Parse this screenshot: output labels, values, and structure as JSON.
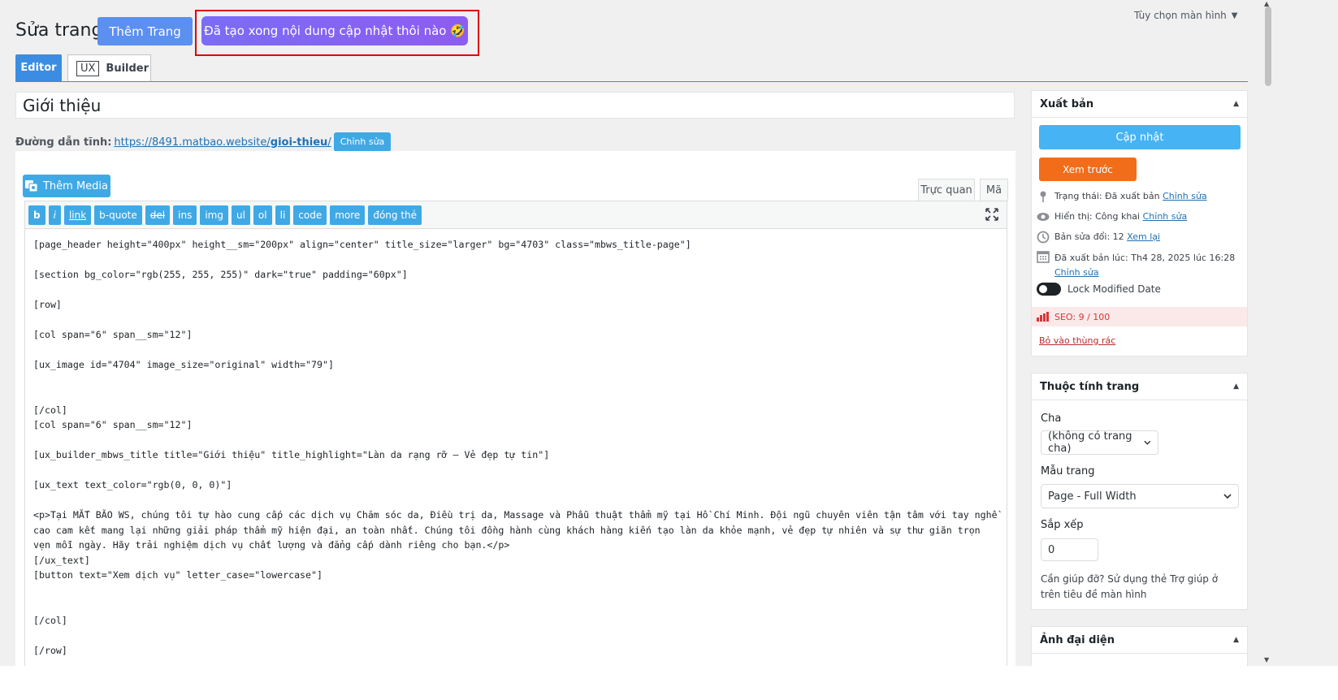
{
  "header": {
    "screen_options": "Tùy chọn màn hình",
    "page_title": "Sửa trang",
    "add_page_button": "Thêm Trang",
    "ai_button": "Đã tạo xong nội dung cập nhật thôi nào 🤣"
  },
  "editor_tabs": {
    "editor": "Editor",
    "ux_badge": "UX",
    "builder": "Builder"
  },
  "post_title": "Giới thiệu",
  "permalink": {
    "label": "Đường dẫn tĩnh:",
    "url_base": "https://8491.matbao.website/",
    "slug": "gioi-thieu",
    "url_end": "/",
    "edit_button": "Chỉnh sửa"
  },
  "media": {
    "add_media": "Thêm Media"
  },
  "mode_tabs": {
    "visual": "Trực quan",
    "code": "Mã"
  },
  "quicktags": [
    "b",
    "i",
    "link",
    "b-quote",
    "del",
    "ins",
    "img",
    "ul",
    "ol",
    "li",
    "code",
    "more",
    "đóng thẻ"
  ],
  "code_content": "[page_header height=\"400px\" height__sm=\"200px\" align=\"center\" title_size=\"larger\" bg=\"4703\" class=\"mbws_title-page\"]\n\n[section bg_color=\"rgb(255, 255, 255)\" dark=\"true\" padding=\"60px\"]\n\n[row]\n\n[col span=\"6\" span__sm=\"12\"]\n\n[ux_image id=\"4704\" image_size=\"original\" width=\"79\"]\n\n\n[/col]\n[col span=\"6\" span__sm=\"12\"]\n\n[ux_builder_mbws_title title=\"Giới thiệu\" title_highlight=\"Làn da rạng rỡ – Vẻ đẹp tự tin\"]\n\n[ux_text text_color=\"rgb(0, 0, 0)\"]\n\n<p>Tại MẮT BÃO WS, chúng tôi tự hào cung cấp các dịch vụ Chăm sóc da, Điều trị da, Massage và Phẫu thuật thẩm mỹ tại Hồ Chí Minh. Đội ngũ chuyên viên tận tâm với tay nghề cao cam kết mang lại những giải pháp thẩm mỹ hiện đại, an toàn nhất. Chúng tôi đồng hành cùng khách hàng kiến tạo làn da khỏe mạnh, vẻ đẹp tự nhiên và sự thư giãn trọn vẹn mỗi ngày. Hãy trải nghiệm dịch vụ chất lượng và đẳng cấp dành riêng cho bạn.</p>\n[/ux_text]\n[button text=\"Xem dịch vụ\" letter_case=\"lowercase\"]\n\n\n[/col]\n\n[/row]",
  "publish": {
    "title": "Xuất bản",
    "update": "Cập nhật",
    "preview": "Xem trước",
    "status_label": "Trạng thái: Đã xuất bản",
    "status_edit": "Chỉnh sửa",
    "visibility_label": "Hiển thị: Công khai",
    "visibility_edit": "Chỉnh sửa",
    "revisions_label": "Bản sửa đổi: 12",
    "revisions_view": "Xem lại",
    "published_label": "Đã xuất bản lúc: Th4 28, 2025 lúc 16:28",
    "published_edit": "Chỉnh sửa",
    "lock_modified": "Lock Modified Date",
    "seo": "SEO: 9 / 100",
    "trash": "Bỏ vào thùng rác"
  },
  "attributes": {
    "title": "Thuộc tính trang",
    "parent_label": "Cha",
    "parent_value": "(không có trang cha)",
    "template_label": "Mẫu trang",
    "template_value": "Page - Full Width",
    "order_label": "Sắp xếp",
    "order_value": "0",
    "help": "Cần giúp đỡ? Sử dụng thẻ Trợ giúp ở trên tiêu đề màn hình"
  },
  "featured": {
    "title": "Ảnh đại diện"
  },
  "colors": {
    "accent_blue": "#3fa9e6",
    "preview_orange": "#f26d1a",
    "highlight_red": "#e00000"
  }
}
